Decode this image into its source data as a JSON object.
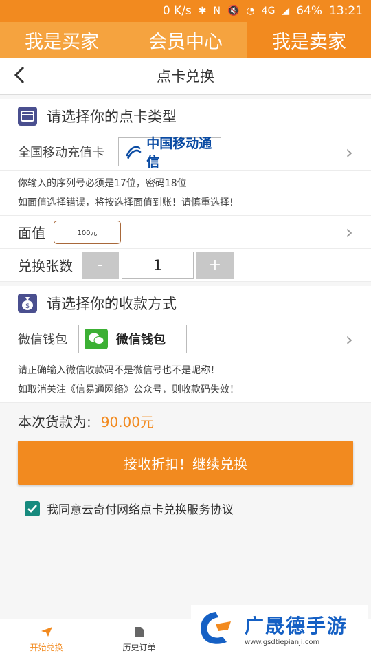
{
  "status_bar": {
    "speed": "0 K/s",
    "battery": "64%",
    "time": "13:21",
    "network": "4G"
  },
  "top_tabs": [
    {
      "label": "我是买家"
    },
    {
      "label": "会员中心"
    },
    {
      "label": "我是卖家"
    }
  ],
  "title_bar": {
    "title": "点卡兑换"
  },
  "card_section": {
    "heading": "请选择你的点卡类型",
    "card_label": "全国移动充值卡",
    "card_logo_text": "中国移动通信",
    "note_lines": [
      "你输入的序列号必须是17位，密码18位",
      "如面值选择错误，将按选择面值到账！请慎重选择!"
    ],
    "value_label": "面值",
    "value_option": "100元",
    "quantity_label": "兑换张数",
    "minus_label": "-",
    "plus_label": "+",
    "quantity_value": "1"
  },
  "payment_section": {
    "heading": "请选择你的收款方式",
    "method_label": "微信钱包",
    "method_logo_text": "微信钱包",
    "note_lines": [
      "请正确输入微信收款码不是微信号也不是昵称！",
      "如取消关注《信易通网络》公众号，则收款码失效！"
    ]
  },
  "total": {
    "label": "本次货款为:",
    "amount": "90.00元"
  },
  "submit_button": "接收折扣！继续兑换",
  "agreement": {
    "checked": true,
    "text": "我同意云奇付网络点卡兑换服务协议"
  },
  "bottom_nav": [
    {
      "label": "开始兑换",
      "active": true
    },
    {
      "label": "历史订单",
      "active": false
    }
  ],
  "watermark": {
    "text": "广晟德手游",
    "url": "www.gsdtiepianji.com"
  },
  "colors": {
    "accent": "#f28a1f",
    "tab_bg": "#f5a33f",
    "section_icon": "#4a4f8f",
    "checkbox": "#178a7e",
    "wechat_green": "#3cb034",
    "watermark_blue": "#1560c4"
  }
}
